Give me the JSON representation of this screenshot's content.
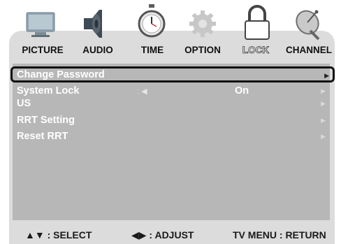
{
  "tabs": [
    {
      "label": "PICTURE",
      "icon": "monitor-icon"
    },
    {
      "label": "AUDIO",
      "icon": "speaker-icon"
    },
    {
      "label": "TIME",
      "icon": "stopwatch-icon"
    },
    {
      "label": "OPTION",
      "icon": "gear-icon"
    },
    {
      "label": "LOCK",
      "icon": "padlock-icon",
      "active": true
    },
    {
      "label": "CHANNEL",
      "icon": "satellite-dish-icon"
    }
  ],
  "menu": {
    "items": [
      {
        "label": "Change Password",
        "arrow": "▶"
      },
      {
        "label": "System Lock",
        "adjust_marker": ": ◀",
        "value": "On",
        "arrow": "▶"
      },
      {
        "label": "US",
        "arrow": "▶"
      },
      {
        "label": "RRT Setting",
        "arrow": "▶"
      },
      {
        "label": "Reset RRT",
        "arrow": "▶"
      }
    ]
  },
  "footer": {
    "select": "▲▼ : SELECT",
    "adjust": "◀▶ : ADJUST",
    "return": "TV MENU : RETURN"
  },
  "colors": {
    "frame": "#dcdcdc",
    "panel": "#b7b7b7",
    "highlight_border": "#111111"
  }
}
